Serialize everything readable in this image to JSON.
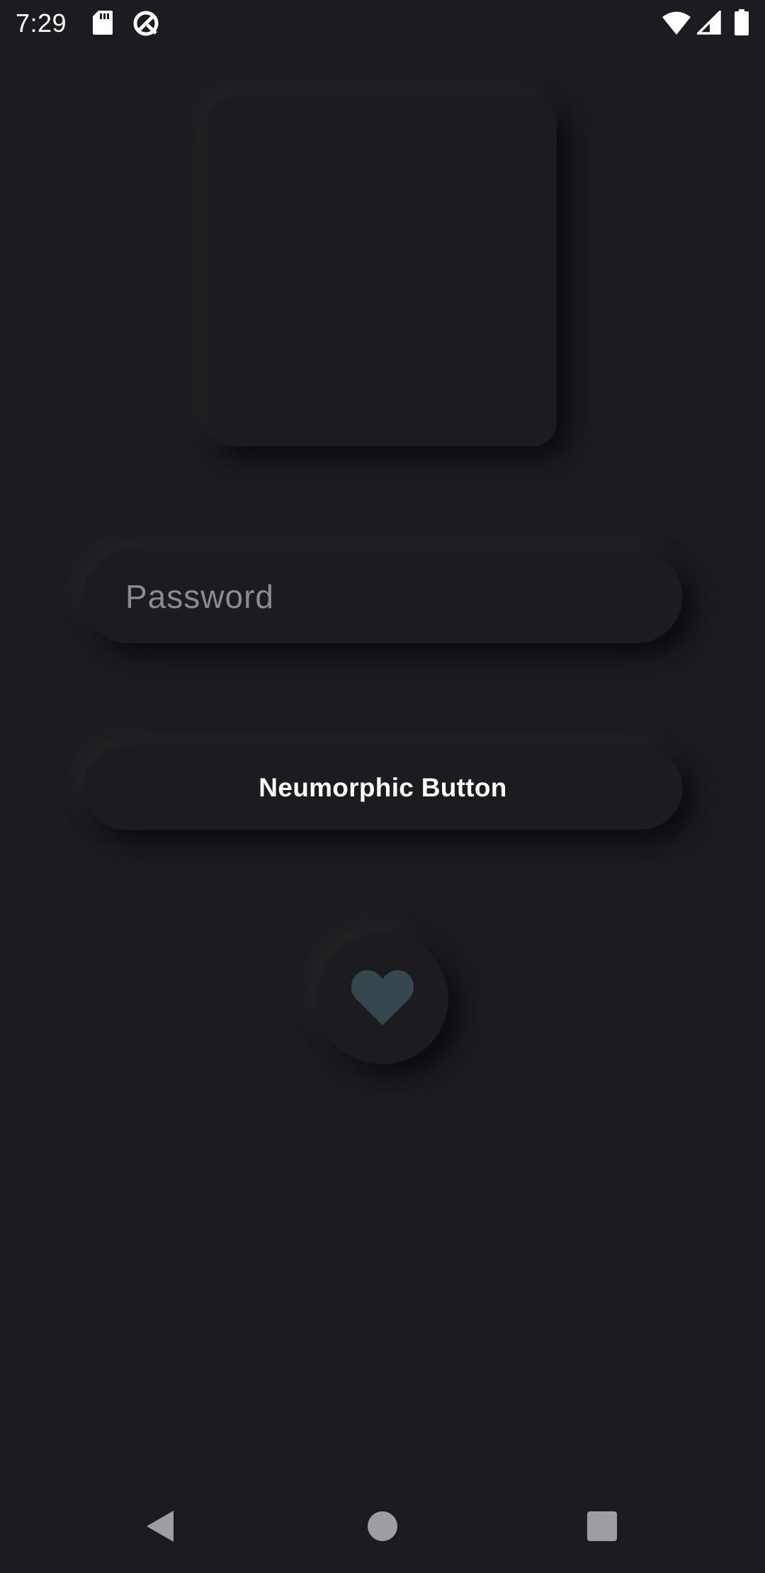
{
  "status_bar": {
    "time": "7:29",
    "icons": [
      "sd-card-icon",
      "sync-icon",
      "wifi-icon",
      "signal-icon",
      "battery-icon"
    ]
  },
  "main": {
    "password_field": {
      "placeholder": "Password",
      "value": ""
    },
    "button": {
      "label": "Neumorphic Button"
    },
    "icon_button": {
      "icon": "heart-icon"
    }
  },
  "navigation_bar": {
    "buttons": [
      "back-icon",
      "home-icon",
      "recents-icon"
    ]
  },
  "colors": {
    "background": "#1c1b20",
    "text_primary": "#ffffff",
    "placeholder": "#8c8b90",
    "heart": "#37474f",
    "nav_icons": "#9e9ea2"
  }
}
